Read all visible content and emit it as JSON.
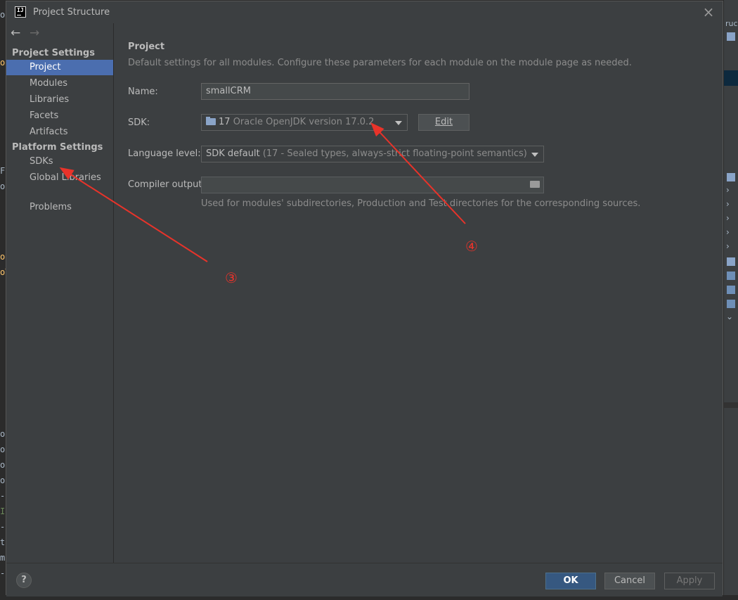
{
  "window": {
    "title": "Project Structure",
    "app_icon_text": "IJ"
  },
  "sidebar": {
    "project_settings_header": "Project Settings",
    "project_items": [
      {
        "label": "Project",
        "selected": true
      },
      {
        "label": "Modules"
      },
      {
        "label": "Libraries"
      },
      {
        "label": "Facets"
      },
      {
        "label": "Artifacts"
      }
    ],
    "platform_settings_header": "Platform Settings",
    "platform_items": [
      {
        "label": "SDKs"
      },
      {
        "label": "Global Libraries"
      }
    ],
    "problems_label": "Problems"
  },
  "main": {
    "heading": "Project",
    "description": "Default settings for all modules. Configure these parameters for each module on the module page as needed.",
    "name_label": "Name:",
    "name_value": "smallCRM",
    "sdk_label": "SDK:",
    "sdk_version": "17",
    "sdk_name": "Oracle OpenJDK version 17.0.2",
    "edit_button": "Edit",
    "language_level_label": "Language level:",
    "language_level_value": "SDK default",
    "language_level_detail": "(17 - Sealed types, always-strict floating-point semantics)",
    "compiler_output_label": "Compiler output:",
    "compiler_output_value": "",
    "compiler_output_hint": "Used for modules' subdirectories, Production and Test directories for the corresponding sources."
  },
  "footer": {
    "help": "?",
    "ok": "OK",
    "cancel": "Cancel",
    "apply": "Apply"
  },
  "annotations": {
    "marker3": "③",
    "marker4": "④",
    "color": "#e8332a"
  },
  "background": {
    "left_fragments": [
      "or",
      "ol",
      "Fi",
      "ou",
      "os",
      "oT",
      "o",
      "o",
      "o",
      "o",
      "-",
      "I",
      "-",
      "t",
      "m",
      "-"
    ],
    "right_fragments": [
      "ruc"
    ]
  },
  "colors": {
    "selection": "#4b6eaf",
    "ok_button": "#365880",
    "dialog_bg": "#3c3f41"
  }
}
